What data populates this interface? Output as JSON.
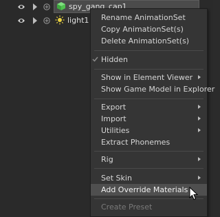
{
  "tree": {
    "rows": [
      {
        "label": "spy_gang_cap1",
        "icon": "green-cube-icon"
      },
      {
        "label": "light1",
        "icon": "yellow-light-icon"
      }
    ]
  },
  "menu": {
    "rename": "Rename AnimationSet",
    "copy": "Copy AnimationSet(s)",
    "delete": "Delete AnimationSet(s)",
    "hidden": "Hidden",
    "show_element_viewer": "Show in Element Viewer",
    "show_game_model": "Show Game Model in Explorer",
    "export": "Export",
    "import": "Import",
    "utilities": "Utilities",
    "extract_phonemes": "Extract Phonemes",
    "rig": "Rig",
    "set_skin": "Set Skin",
    "add_override_materials": "Add Override Materials",
    "create_preset": "Create Preset"
  },
  "colors": {
    "background": "#2a2a2a",
    "menu_background": "#353535",
    "hover": "#4f4f4f",
    "cube_green": "#4fc24f",
    "light_yellow": "#e8d040"
  }
}
